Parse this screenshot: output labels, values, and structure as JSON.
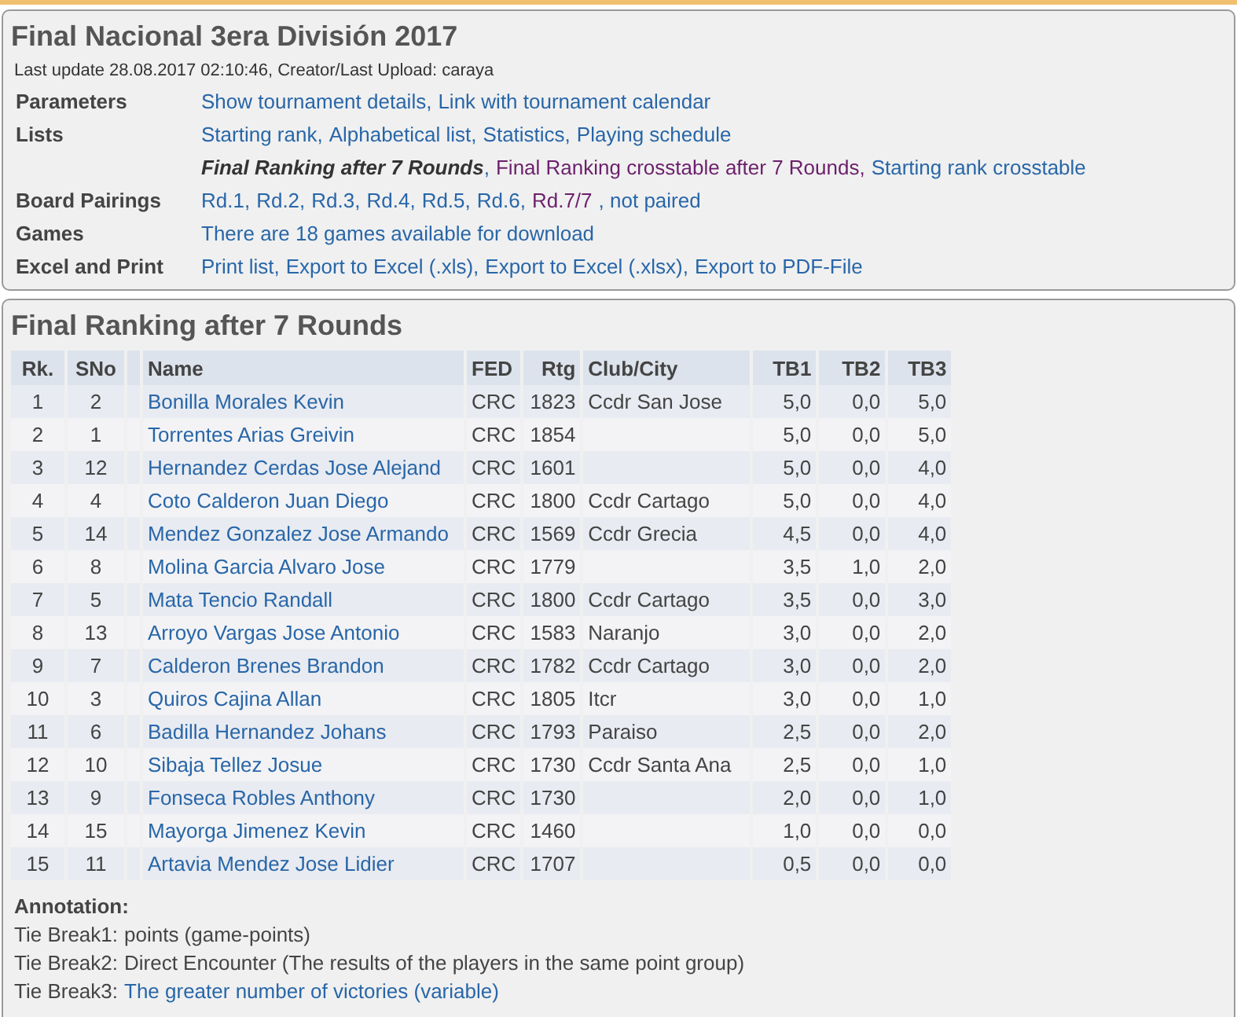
{
  "header": {
    "title": "Final Nacional 3era División 2017",
    "last_update": "Last update 28.08.2017 02:10:46, Creator/Last Upload: caraya"
  },
  "info_rows": [
    {
      "label": "Parameters",
      "links": [
        {
          "text": "Show tournament details,",
          "kind": "link"
        },
        {
          "text": "Link with tournament calendar",
          "kind": "link"
        }
      ]
    },
    {
      "label": "Lists",
      "links": [
        {
          "text": "Starting rank,",
          "kind": "link"
        },
        {
          "text": "Alphabetical list,",
          "kind": "link"
        },
        {
          "text": "Statistics,",
          "kind": "link"
        },
        {
          "text": "Playing schedule",
          "kind": "link"
        }
      ]
    },
    {
      "label": "",
      "links": [
        {
          "text": "Final Ranking after 7 Rounds",
          "kind": "current",
          "suffix": ","
        },
        {
          "text": "Final Ranking crosstable after 7 Rounds,",
          "kind": "visited"
        },
        {
          "text": "Starting rank crosstable",
          "kind": "link"
        }
      ]
    },
    {
      "label": "Board Pairings",
      "links": [
        {
          "text": "Rd.1,",
          "kind": "link"
        },
        {
          "text": "Rd.2,",
          "kind": "link"
        },
        {
          "text": "Rd.3,",
          "kind": "link"
        },
        {
          "text": "Rd.4,",
          "kind": "link"
        },
        {
          "text": "Rd.5,",
          "kind": "link"
        },
        {
          "text": "Rd.6,",
          "kind": "link"
        },
        {
          "text": "Rd.7/7",
          "kind": "visited"
        },
        {
          "text": ", not paired",
          "kind": "link"
        }
      ]
    },
    {
      "label": "Games",
      "links": [
        {
          "text": "There are 18 games available for download",
          "kind": "link"
        }
      ]
    },
    {
      "label": "Excel and Print",
      "links": [
        {
          "text": "Print list,",
          "kind": "link"
        },
        {
          "text": "Export to Excel (.xls),",
          "kind": "link"
        },
        {
          "text": "Export to Excel (.xlsx),",
          "kind": "link"
        },
        {
          "text": "Export to PDF-File",
          "kind": "link"
        }
      ]
    }
  ],
  "ranking": {
    "title": "Final Ranking after 7 Rounds",
    "columns": [
      "Rk.",
      "SNo",
      "Name",
      "FED",
      "Rtg",
      "Club/City",
      "TB1",
      "TB2",
      "TB3"
    ],
    "rows": [
      [
        "1",
        "2",
        "Bonilla Morales Kevin",
        "CRC",
        "1823",
        "Ccdr San Jose",
        "5,0",
        "0,0",
        "5,0"
      ],
      [
        "2",
        "1",
        "Torrentes Arias Greivin",
        "CRC",
        "1854",
        "",
        "5,0",
        "0,0",
        "5,0"
      ],
      [
        "3",
        "12",
        "Hernandez Cerdas Jose Alejand",
        "CRC",
        "1601",
        "",
        "5,0",
        "0,0",
        "4,0"
      ],
      [
        "4",
        "4",
        "Coto Calderon Juan Diego",
        "CRC",
        "1800",
        "Ccdr Cartago",
        "5,0",
        "0,0",
        "4,0"
      ],
      [
        "5",
        "14",
        "Mendez Gonzalez Jose Armando",
        "CRC",
        "1569",
        "Ccdr Grecia",
        "4,5",
        "0,0",
        "4,0"
      ],
      [
        "6",
        "8",
        "Molina Garcia Alvaro Jose",
        "CRC",
        "1779",
        "",
        "3,5",
        "1,0",
        "2,0"
      ],
      [
        "7",
        "5",
        "Mata Tencio Randall",
        "CRC",
        "1800",
        "Ccdr Cartago",
        "3,5",
        "0,0",
        "3,0"
      ],
      [
        "8",
        "13",
        "Arroyo Vargas Jose Antonio",
        "CRC",
        "1583",
        "Naranjo",
        "3,0",
        "0,0",
        "2,0"
      ],
      [
        "9",
        "7",
        "Calderon Brenes Brandon",
        "CRC",
        "1782",
        "Ccdr Cartago",
        "3,0",
        "0,0",
        "2,0"
      ],
      [
        "10",
        "3",
        "Quiros Cajina Allan",
        "CRC",
        "1805",
        "Itcr",
        "3,0",
        "0,0",
        "1,0"
      ],
      [
        "11",
        "6",
        "Badilla Hernandez Johans",
        "CRC",
        "1793",
        "Paraiso",
        "2,5",
        "0,0",
        "2,0"
      ],
      [
        "12",
        "10",
        "Sibaja Tellez Josue",
        "CRC",
        "1730",
        "Ccdr Santa Ana",
        "2,5",
        "0,0",
        "1,0"
      ],
      [
        "13",
        "9",
        "Fonseca Robles Anthony",
        "CRC",
        "1730",
        "",
        "2,0",
        "0,0",
        "1,0"
      ],
      [
        "14",
        "15",
        "Mayorga Jimenez Kevin",
        "CRC",
        "1460",
        "",
        "1,0",
        "0,0",
        "0,0"
      ],
      [
        "15",
        "11",
        "Artavia Mendez Jose Lidier",
        "CRC",
        "1707",
        "",
        "0,5",
        "0,0",
        "0,0"
      ]
    ]
  },
  "annotation": {
    "title": "Annotation:",
    "lines": [
      {
        "label": "Tie Break1:",
        "text": "points (game-points)",
        "kind": "plain"
      },
      {
        "label": "Tie Break2:",
        "text": "Direct Encounter (The results of the players in the same point group)",
        "kind": "plain"
      },
      {
        "label": "Tie Break3:",
        "text": "The greater number of victories (variable)",
        "kind": "link"
      }
    ]
  }
}
